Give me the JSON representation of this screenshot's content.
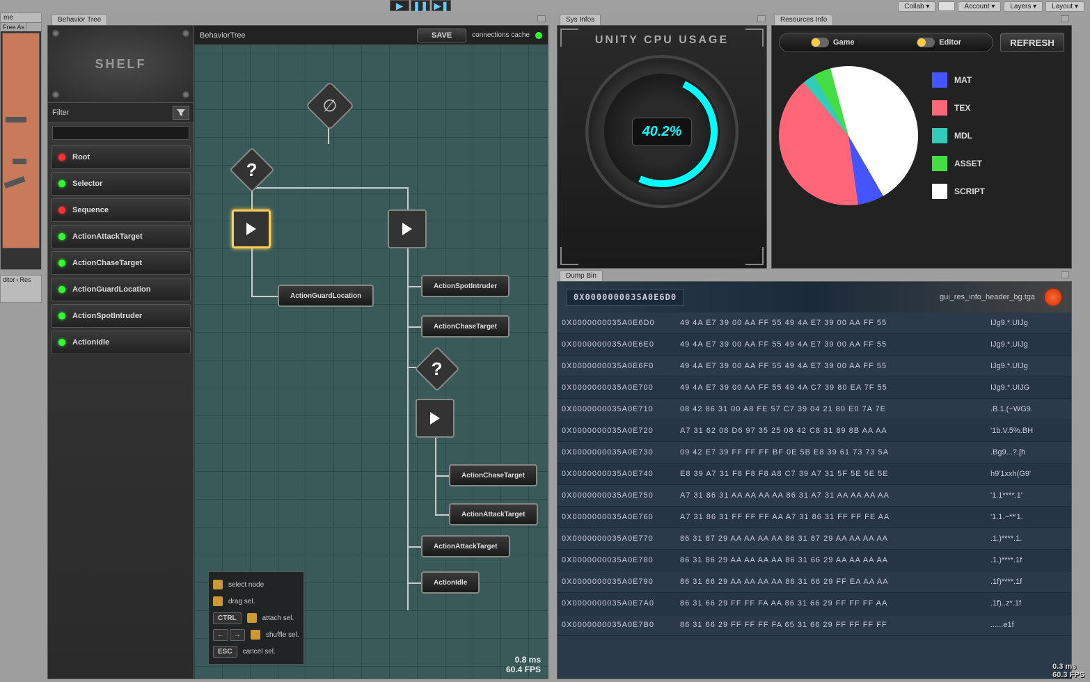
{
  "topbar": {
    "collab": "Collab ▾",
    "account": "Account ▾",
    "layers": "Layers ▾",
    "layout": "Layout ▾"
  },
  "left_fragments": {
    "tab1": "me",
    "tab2": "Free As",
    "tab3": "ditor",
    "tab4": "Res"
  },
  "behavior_tree": {
    "tab": "Behavior Tree",
    "shelf_title": "SHELF",
    "filter_label": "Filter",
    "toolbar": {
      "title": "BehaviorTree",
      "save": "SAVE",
      "cache": "connections cache"
    },
    "shelf_items": [
      {
        "dot": "red",
        "label": "Root"
      },
      {
        "dot": "green",
        "label": "Selector"
      },
      {
        "dot": "red",
        "label": "Sequence"
      },
      {
        "dot": "green",
        "label": "ActionAttackTarget"
      },
      {
        "dot": "green",
        "label": "ActionChaseTarget"
      },
      {
        "dot": "green",
        "label": "ActionGuardLocation"
      },
      {
        "dot": "green",
        "label": "ActionSpotIntruder"
      },
      {
        "dot": "green",
        "label": "ActionIdle"
      }
    ],
    "nodes": {
      "root": "∅",
      "selector": "?",
      "action_guard": "ActionGuardLocation",
      "action_spot": "ActionSpotIntruder",
      "action_chase1": "ActionChaseTarget",
      "selector2": "?",
      "action_chase2": "ActionChaseTarget",
      "action_attack1": "ActionAttackTarget",
      "action_attack2": "ActionAttackTarget",
      "action_idle": "ActionIdle"
    },
    "hints": {
      "select": "select node",
      "drag": "drag   sel.",
      "attach": "attach sel.",
      "shuffle": "shuffle sel.",
      "cancel": "cancel sel.",
      "ctrl": "CTRL",
      "esc": "ESC",
      "left": "←",
      "right": "→"
    },
    "stats": {
      "ms": "0.8 ms",
      "fps": "60.4 FPS"
    }
  },
  "sys": {
    "tab": "Sys Infos",
    "title": "UNITY CPU USAGE",
    "value": "40.2%"
  },
  "resources": {
    "tab": "Resources Info",
    "toggle_game": "Game",
    "toggle_editor": "Editor",
    "refresh": "REFRESH",
    "legend": [
      {
        "color": "#4455ff",
        "label": "MAT"
      },
      {
        "color": "#ff6677",
        "label": "TEX"
      },
      {
        "color": "#33ccbb",
        "label": "MDL"
      },
      {
        "color": "#44dd44",
        "label": "ASSET"
      },
      {
        "color": "#ffffff",
        "label": "SCRIPT"
      }
    ]
  },
  "chart_data": {
    "type": "pie",
    "title": "Resources Info",
    "series": [
      {
        "name": "MAT",
        "value": 6,
        "color": "#4455ff"
      },
      {
        "name": "TEX",
        "value": 41,
        "color": "#ff6677"
      },
      {
        "name": "MDL",
        "value": 3,
        "color": "#33ccbb"
      },
      {
        "name": "ASSET",
        "value": 4,
        "color": "#44dd44"
      },
      {
        "name": "SCRIPT",
        "value": 46,
        "color": "#ffffff"
      }
    ]
  },
  "dump": {
    "tab": "Dump Bin",
    "header_addr": "0X0000000035A0E6D0",
    "filename": "gui_res_info_header_bg.tga",
    "rows": [
      {
        "a": "0X0000000035A0E6D0",
        "h": "49 4A E7 39 00 AA FF 55 49 4A E7 39 00 AA FF 55",
        "s": "IJg9.*.UIJg"
      },
      {
        "a": "0X0000000035A0E6E0",
        "h": "49 4A E7 39 00 AA FF 55 49 4A E7 39 00 AA FF 55",
        "s": "IJg9.*.UIJg"
      },
      {
        "a": "0X0000000035A0E6F0",
        "h": "49 4A E7 39 00 AA FF 55 49 4A E7 39 00 AA FF 55",
        "s": "IJg9.*.UIJg"
      },
      {
        "a": "0X0000000035A0E700",
        "h": "49 4A E7 39 00 AA FF 55 49 4A C7 39 80 EA 7F 55",
        "s": "IJg9.*.UIJG"
      },
      {
        "a": "0X0000000035A0E710",
        "h": "08 42 86 31 00 A8 FE 57 C7 39 04 21 80 E0 7A 7E",
        "s": ".B.1.(~WG9."
      },
      {
        "a": "0X0000000035A0E720",
        "h": "A7 31 62 08 D6 97 35 25 08 42 C8 31 89 8B AA AA",
        "s": "'1b.V.5%.BH"
      },
      {
        "a": "0X0000000035A0E730",
        "h": "09 42 E7 39 FF FF FF BF 0E 5B E8 39 61 73 73 5A",
        "s": ".Bg9...?.[h"
      },
      {
        "a": "0X0000000035A0E740",
        "h": "E8 39 A7 31 F8 F8 F8 A8 C7 39 A7 31 5F 5E 5E 5E",
        "s": "h9'1xxh(G9'"
      },
      {
        "a": "0X0000000035A0E750",
        "h": "A7 31 86 31 AA AA AA AA 86 31 A7 31 AA AA AA AA",
        "s": "'1.1****.1'"
      },
      {
        "a": "0X0000000035A0E760",
        "h": "A7 31 86 31 FF FF FF AA A7 31 86 31 FF FF FE AA",
        "s": "'1.1.~**'1."
      },
      {
        "a": "0X0000000035A0E770",
        "h": "86 31 87 29 AA AA AA AA 86 31 87 29 AA AA AA AA",
        "s": ".1.)****.1."
      },
      {
        "a": "0X0000000035A0E780",
        "h": "86 31 86 29 AA AA AA AA 86 31 66 29 AA AA AA AA",
        "s": ".1.)****.1f"
      },
      {
        "a": "0X0000000035A0E790",
        "h": "86 31 66 29 AA AA AA AA 86 31 66 29 FF EA AA AA",
        "s": ".1f)****.1f"
      },
      {
        "a": "0X0000000035A0E7A0",
        "h": "86 31 66 29 FF FF FA AA 86 31 66 29 FF FF FF AA",
        "s": ".1f)..z*.1f"
      },
      {
        "a": "0X0000000035A0E7B0",
        "h": "86 31 66 29 FF FF FF FA 65 31 66 29 FF FF FF FF",
        "s": "......e1f"
      }
    ]
  },
  "status": {
    "ms": "0.3 ms",
    "fps": "60.3 FPS"
  }
}
